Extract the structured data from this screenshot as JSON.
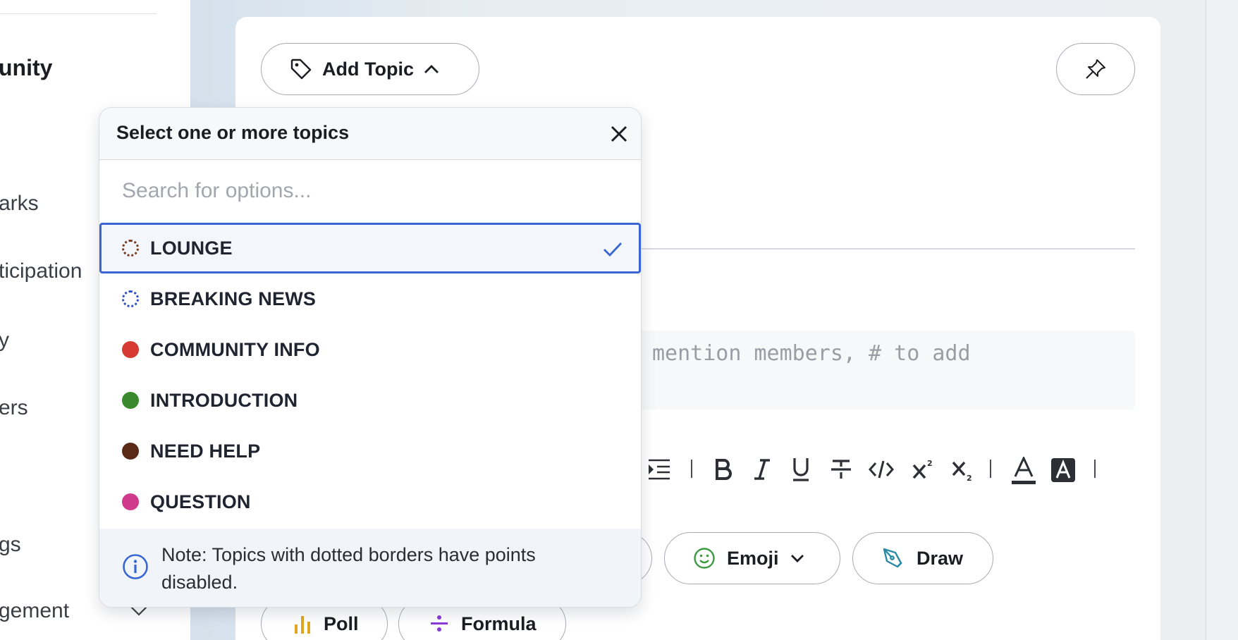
{
  "sidebar": {
    "title": "unity",
    "items": [
      {
        "label": "arks"
      },
      {
        "label": "ticipation"
      },
      {
        "label": "y"
      },
      {
        "label": "ers"
      },
      {
        "label": "gs"
      },
      {
        "label": "gement"
      }
    ]
  },
  "editor": {
    "add_topic_label": "Add Topic",
    "body_placeholder": "mention members, # to add",
    "buttons": {
      "emoji": "Emoji",
      "draw": "Draw",
      "poll": "Poll",
      "formula": "Formula"
    }
  },
  "dropdown": {
    "title": "Select one or more topics",
    "search_placeholder": "Search for options...",
    "options": [
      {
        "label": "LOUNGE",
        "color": "#7a3b1c",
        "dotted": true,
        "selected": true
      },
      {
        "label": "BREAKING NEWS",
        "color": "#2c4fc2",
        "dotted": true,
        "selected": false
      },
      {
        "label": "COMMUNITY INFO",
        "color": "#d63a33",
        "dotted": false,
        "selected": false
      },
      {
        "label": "INTRODUCTION",
        "color": "#3a8a2d",
        "dotted": false,
        "selected": false
      },
      {
        "label": "NEED HELP",
        "color": "#5a2a17",
        "dotted": false,
        "selected": false
      },
      {
        "label": "QUESTION",
        "color": "#d1398c",
        "dotted": false,
        "selected": false
      }
    ],
    "note": "Note: Topics with dotted borders have points disabled."
  },
  "colors": {
    "accent": "#3a66d3",
    "emoji_icon": "#3c9a3f",
    "draw_icon": "#2a8aa3",
    "poll_icon": "#e2a623",
    "formula_icon": "#8a3bd6"
  }
}
